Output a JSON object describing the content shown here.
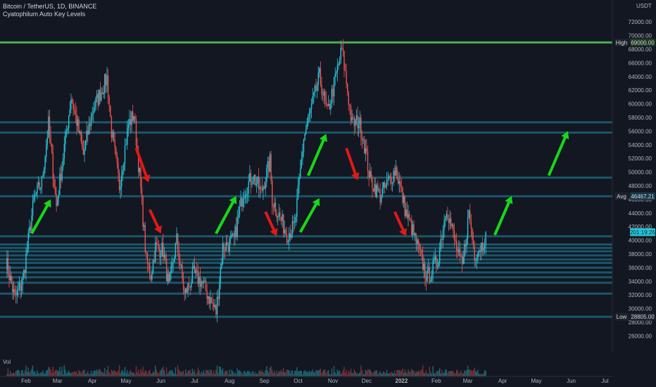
{
  "header": {
    "symbol_line": "Bitcoin / TetherUS, 1D, BINANCE",
    "indicator_line": "Cyatophilum Auto Key Levels"
  },
  "volume_label": "Vol",
  "chart_data": {
    "type": "candlestick",
    "currency": "USDT",
    "ylim": [
      24600,
      73200
    ],
    "y_ticks": [
      26000,
      28000,
      30000,
      32000,
      34000,
      36000,
      38000,
      40000,
      42000,
      44000,
      46000,
      48000,
      50000,
      52000,
      54000,
      56000,
      58000,
      60000,
      62000,
      64000,
      66000,
      68000,
      70000,
      72000
    ],
    "x_ticks": [
      "Feb",
      "Mar",
      "Apr",
      "May",
      "Jun",
      "Jul",
      "Aug",
      "Sep",
      "Oct",
      "Nov",
      "Dec",
      "2022",
      "Feb",
      "Mar",
      "Apr",
      "May",
      "Jun",
      "Jul"
    ],
    "price_path": [
      [
        "2021-01-14",
        37000
      ],
      [
        "2021-01-22",
        31500
      ],
      [
        "2021-01-29",
        34000
      ],
      [
        "2021-02-08",
        46000
      ],
      [
        "2021-02-15",
        48500
      ],
      [
        "2021-02-21",
        57000
      ],
      [
        "2021-02-28",
        45000
      ],
      [
        "2021-03-13",
        61000
      ],
      [
        "2021-03-18",
        57500
      ],
      [
        "2021-03-24",
        52500
      ],
      [
        "2021-04-01",
        59000
      ],
      [
        "2021-04-14",
        63800
      ],
      [
        "2021-04-18",
        56000
      ],
      [
        "2021-04-25",
        48000
      ],
      [
        "2021-05-03",
        57000
      ],
      [
        "2021-05-08",
        58500
      ],
      [
        "2021-05-13",
        49500
      ],
      [
        "2021-05-19",
        37000
      ],
      [
        "2021-05-23",
        35000
      ],
      [
        "2021-05-27",
        39000
      ],
      [
        "2021-06-03",
        38500
      ],
      [
        "2021-06-08",
        33000
      ],
      [
        "2021-06-15",
        40000
      ],
      [
        "2021-06-22",
        32000
      ],
      [
        "2021-06-30",
        35000
      ],
      [
        "2021-07-07",
        34000
      ],
      [
        "2021-07-20",
        29500
      ],
      [
        "2021-07-26",
        39000
      ],
      [
        "2021-08-05",
        40000
      ],
      [
        "2021-08-13",
        47000
      ],
      [
        "2021-08-22",
        49500
      ],
      [
        "2021-08-29",
        47000
      ],
      [
        "2021-09-06",
        51500
      ],
      [
        "2021-09-08",
        46000
      ],
      [
        "2021-09-21",
        41000
      ],
      [
        "2021-09-28",
        42000
      ],
      [
        "2021-10-06",
        55000
      ],
      [
        "2021-10-20",
        64000
      ],
      [
        "2021-10-27",
        58500
      ],
      [
        "2021-11-09",
        68000
      ],
      [
        "2021-11-18",
        57000
      ],
      [
        "2021-11-24",
        57500
      ],
      [
        "2021-11-28",
        55000
      ],
      [
        "2021-12-04",
        49000
      ],
      [
        "2021-12-13",
        46500
      ],
      [
        "2021-12-27",
        50500
      ],
      [
        "2022-01-05",
        44000
      ],
      [
        "2022-01-10",
        41800
      ],
      [
        "2022-01-21",
        36000
      ],
      [
        "2022-01-24",
        34500
      ],
      [
        "2022-02-02",
        37000
      ],
      [
        "2022-02-10",
        45000
      ],
      [
        "2022-02-20",
        38000
      ],
      [
        "2022-02-24",
        36000
      ],
      [
        "2022-03-02",
        44000
      ],
      [
        "2022-03-07",
        38000
      ],
      [
        "2022-03-14",
        39500
      ],
      [
        "2022-03-17",
        41200
      ]
    ],
    "key_levels": [
      {
        "price": 69000,
        "label": "High",
        "value_label": "69000.00",
        "color": "#4caf50"
      },
      {
        "price": 57300
      },
      {
        "price": 55800
      },
      {
        "price": 49200
      },
      {
        "price": 46467.21,
        "label": "Avg",
        "value_label": "46467.21"
      },
      {
        "price": 40600
      },
      {
        "price": 39400
      },
      {
        "price": 38900
      },
      {
        "price": 38400
      },
      {
        "price": 37800
      },
      {
        "price": 37200
      },
      {
        "price": 36700
      },
      {
        "price": 36000
      },
      {
        "price": 35300
      },
      {
        "price": 34600
      },
      {
        "price": 33800
      },
      {
        "price": 32200
      },
      {
        "price": 28805,
        "label": "Low",
        "value_label": "28805.00"
      }
    ],
    "current_price": {
      "price": 41200,
      "value_label": "201:19:26",
      "color": "#26c6da"
    },
    "annotations": {
      "arrows_down": [
        [
          "2021-05-10",
          53500,
          "2021-05-21",
          48500
        ],
        [
          "2021-05-22",
          44500,
          "2021-06-01",
          41000
        ],
        [
          "2021-09-02",
          44200,
          "2021-09-12",
          40600
        ],
        [
          "2021-11-13",
          53500,
          "2021-11-23",
          48800
        ],
        [
          "2021-12-26",
          44200,
          "2022-01-05",
          40600
        ]
      ],
      "arrows_up": [
        [
          "2021-02-06",
          41000,
          "2021-02-23",
          46000
        ],
        [
          "2021-07-20",
          41000,
          "2021-08-07",
          46500
        ],
        [
          "2021-10-03",
          41200,
          "2021-10-20",
          46200
        ],
        [
          "2021-10-10",
          49500,
          "2021-10-26",
          55600
        ],
        [
          "2022-03-25",
          40800,
          "2022-04-09",
          46500
        ],
        [
          "2022-05-12",
          49500,
          "2022-05-29",
          56000
        ]
      ],
      "up_color": "#18d817",
      "down_color": "#e01919"
    },
    "colors": {
      "up": "#26c6da",
      "down": "#ef5350",
      "level": "#1a5a6e",
      "background": "#131722"
    }
  }
}
